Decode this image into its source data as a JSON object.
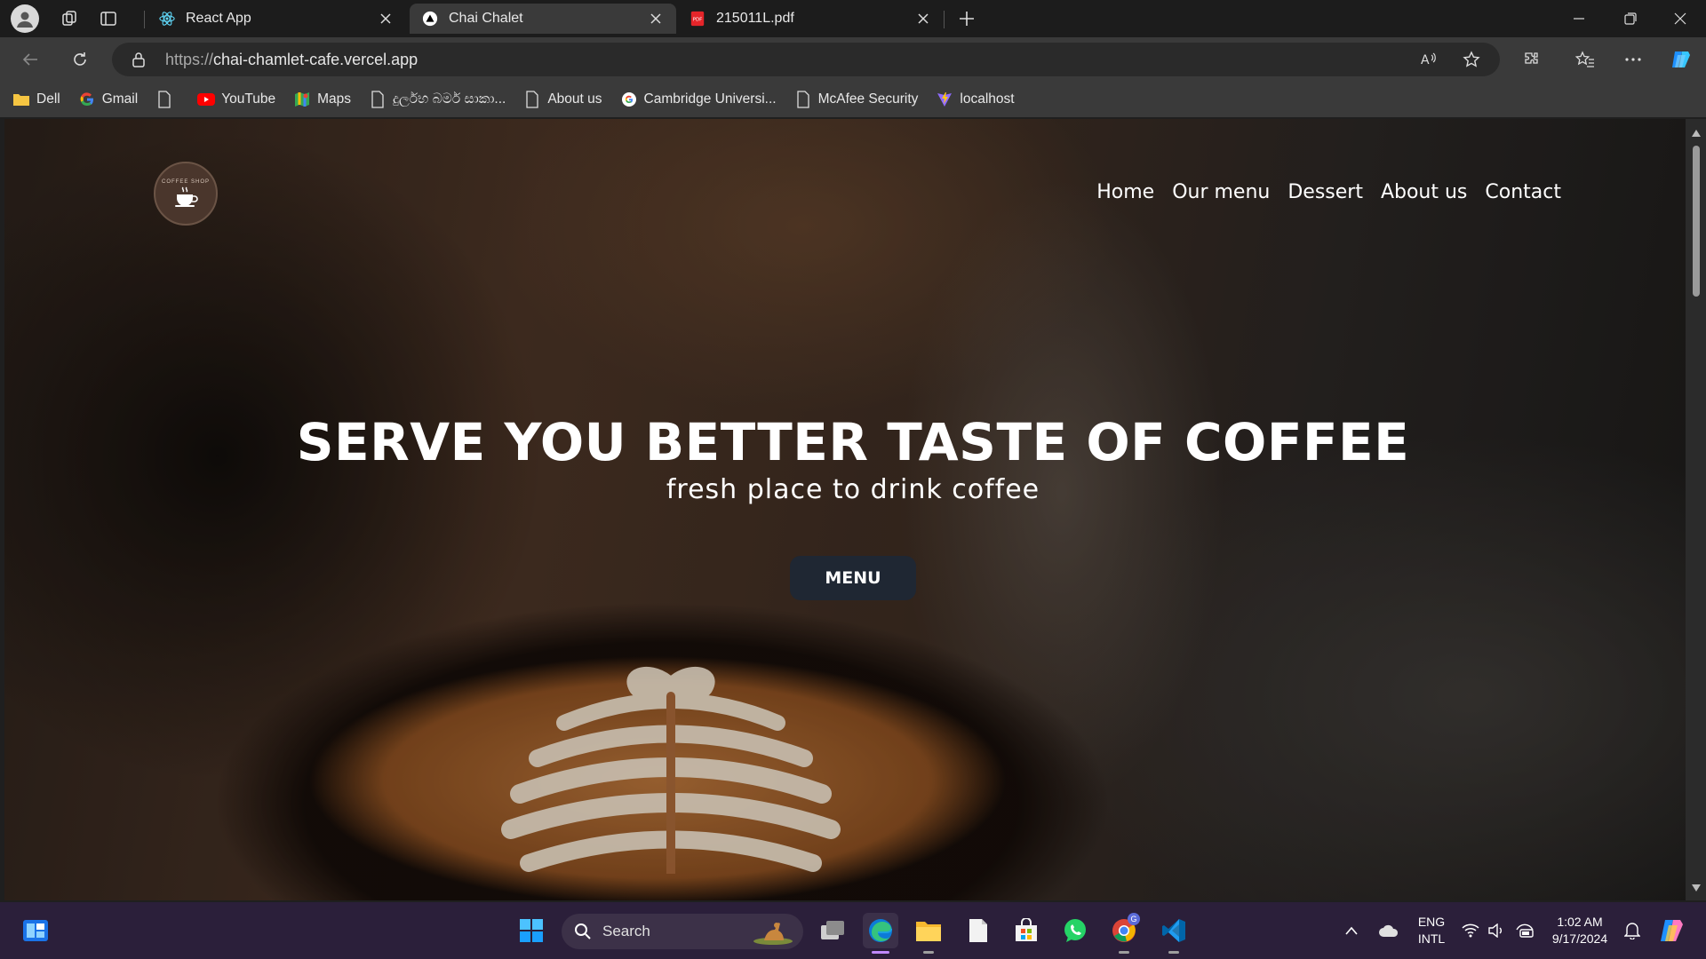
{
  "browser": {
    "tabs": [
      {
        "title": "React App",
        "icon": "react-icon",
        "active": false
      },
      {
        "title": "Chai Chalet",
        "icon": "vercel-icon",
        "active": true
      },
      {
        "title": "215011L.pdf",
        "icon": "pdf-icon",
        "active": false
      }
    ],
    "url": {
      "scheme": "https://",
      "host": "chai-chamlet-cafe.vercel.app"
    },
    "bookmarks": [
      {
        "label": "Dell",
        "icon": "folder-icon"
      },
      {
        "label": "Gmail",
        "icon": "google-icon"
      },
      {
        "label": "",
        "icon": "page-icon"
      },
      {
        "label": "YouTube",
        "icon": "youtube-icon"
      },
      {
        "label": "Maps",
        "icon": "maps-icon"
      },
      {
        "label": "දුර්ලභ බර්ම සාකා...",
        "icon": "page-icon"
      },
      {
        "label": "About us",
        "icon": "page-icon"
      },
      {
        "label": "Cambridge Universi...",
        "icon": "google-icon"
      },
      {
        "label": "McAfee Security",
        "icon": "page-icon"
      },
      {
        "label": "localhost",
        "icon": "vite-icon"
      }
    ]
  },
  "site": {
    "logo_text": "COFFEE SHOP",
    "nav": [
      "Home",
      "Our menu",
      "Dessert",
      "About us",
      "Contact"
    ],
    "hero_title": "SERVE YOU BETTER TASTE OF COFFEE",
    "hero_subtitle": "fresh place to drink coffee",
    "cta_label": "MENU",
    "colors": {
      "cta_bg": "#1f2733",
      "text": "#ffffff"
    }
  },
  "taskbar": {
    "search_label": "Search",
    "language": {
      "line1": "ENG",
      "line2": "INTL"
    },
    "clock": {
      "time": "1:02 AM",
      "date": "9/17/2024"
    },
    "chrome_badge": "G"
  }
}
